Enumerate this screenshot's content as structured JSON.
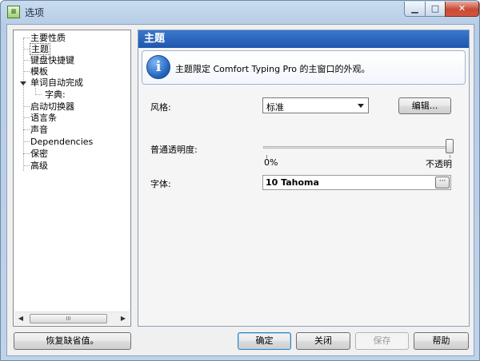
{
  "window": {
    "title": "选项",
    "app_icon": "options-app-icon",
    "minimize_symbol": "▁",
    "maximize_symbol": "□",
    "close_symbol": "✕"
  },
  "tree": {
    "items": [
      {
        "label": "主要性质"
      },
      {
        "label": "主题",
        "selected": true
      },
      {
        "label": "键盘快捷键"
      },
      {
        "label": "模板"
      },
      {
        "label": "单词自动完成",
        "expanded": true
      },
      {
        "label": "字典:"
      },
      {
        "label": "启动切换器"
      },
      {
        "label": "语言条"
      },
      {
        "label": "声音"
      },
      {
        "label": "Dependencies"
      },
      {
        "label": "保密"
      },
      {
        "label": "高级"
      }
    ],
    "scroll_left": "◀",
    "scroll_right": "▶",
    "scroll_grip": "III"
  },
  "panel": {
    "header": "主题",
    "info_text": "主题限定 Comfort Typing Pro 的主窗口的外观。",
    "style_label": "风格:",
    "style_value": "标准",
    "edit_button": "编辑...",
    "opacity_label": "普通透明度:",
    "opacity_min_label": "0%",
    "opacity_max_label": "不透明",
    "opacity_value": 1.0,
    "font_label": "字体:",
    "font_value": "10 Tahoma",
    "font_browse": "···"
  },
  "footer": {
    "restore_defaults": "恢复缺省值。",
    "ok": "确定",
    "close": "关闭",
    "save": "保存",
    "help": "帮助"
  },
  "colors": {
    "header_blue": "#2b66bf",
    "info_border": "#9db4d2",
    "close_button_red": "#c94a34"
  }
}
